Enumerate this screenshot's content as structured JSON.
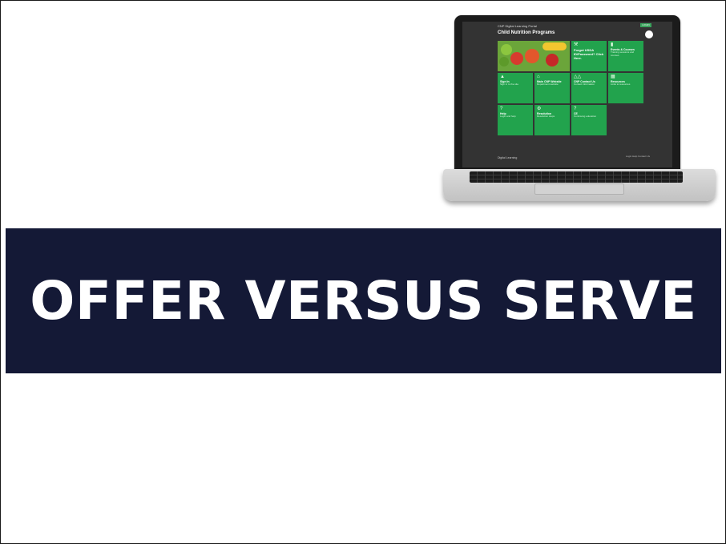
{
  "colors": {
    "banner_background": "#141936",
    "banner_text": "#ffffff",
    "tile_green": "#22a34d"
  },
  "slide": {
    "title": "OFFER VERSUS SERVE"
  },
  "laptop_screen": {
    "portal_name": "CNP Digital Learning Portal",
    "login_label": "LOGIN",
    "heading": "Child Nutrition Programs",
    "tiles": [
      {
        "icon": "fruit-photo",
        "title": "",
        "sub": ""
      },
      {
        "icon": "wrench-icon",
        "title": "Forgot USDA ID/Password? Click Here.",
        "sub": ""
      },
      {
        "icon": "book-icon",
        "title": "Events & Courses",
        "sub": "Training sessions and courses"
      },
      {
        "icon": "person-icon",
        "title": "Sign In",
        "sub": "Sign in to the site"
      },
      {
        "icon": "home-icon",
        "title": "Main CNP Website",
        "sub": "Department website"
      },
      {
        "icon": "group-icon",
        "title": "CNP Contact Us",
        "sub": "Contact information"
      },
      {
        "icon": "resources-icon",
        "title": "Resources",
        "sub": "Links to resources"
      },
      {
        "icon": "question-icon",
        "title": "Help",
        "sub": "Login and help"
      },
      {
        "icon": "gear-icon",
        "title": "Resolution",
        "sub": "Resolution steps"
      },
      {
        "icon": "question-icon",
        "title": "CE",
        "sub": "Continuing education"
      }
    ],
    "footer_logo": "Digital Learning",
    "footer_links": "Login  Help  Contact Us"
  }
}
